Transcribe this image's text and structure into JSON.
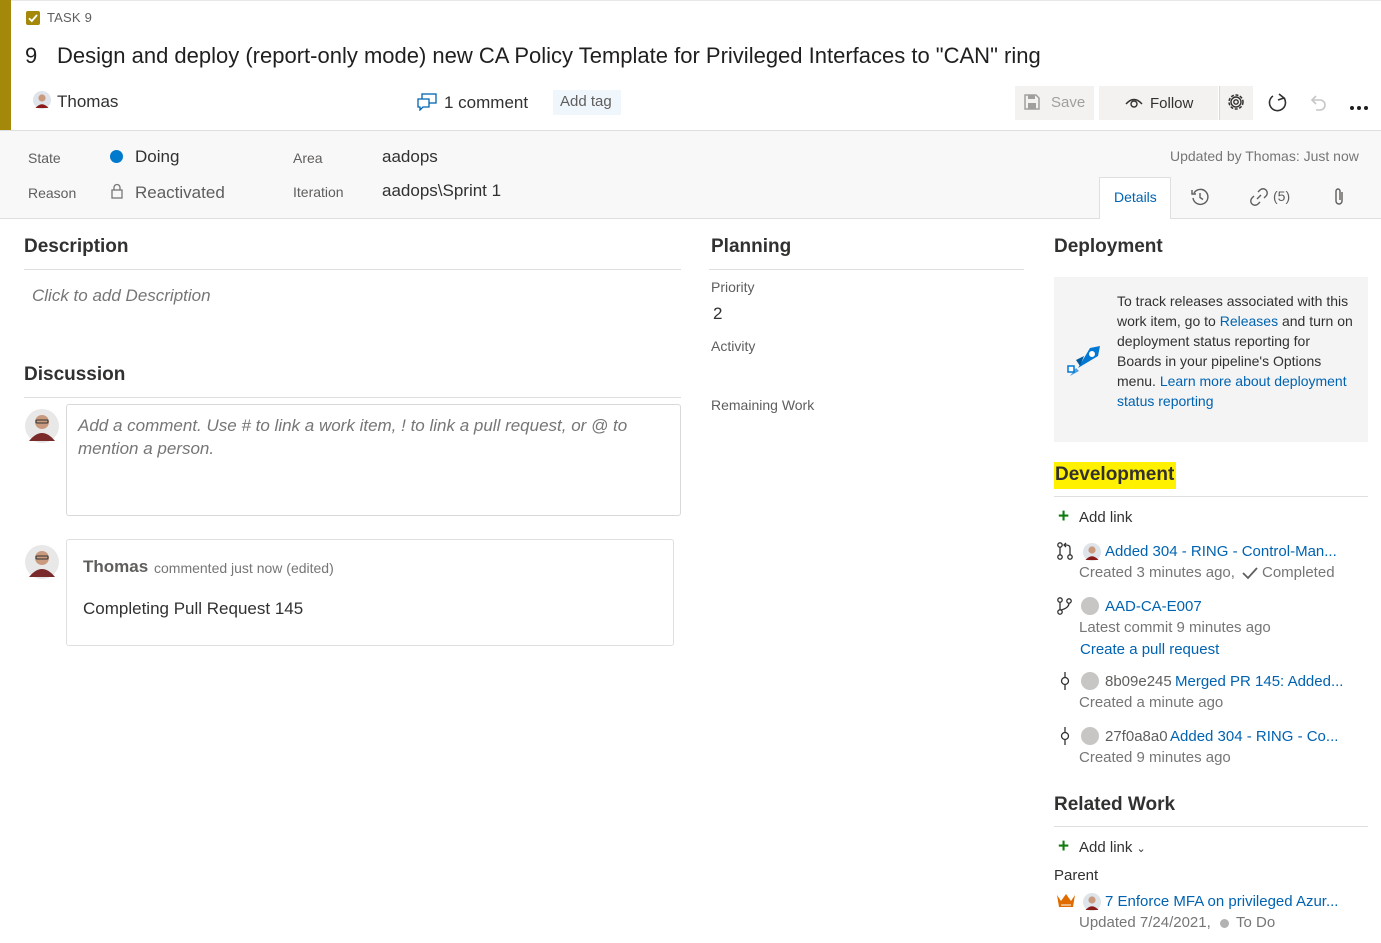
{
  "header": {
    "type_label": "TASK 9",
    "id": "9",
    "title": "Design and deploy (report-only mode) new CA Policy Template for Privileged Interfaces to \"CAN\" ring",
    "assignee": "Thomas",
    "comment_count": "1 comment",
    "add_tag": "Add tag",
    "accent_color": "#a4880a"
  },
  "toolbar": {
    "save_label": "Save",
    "follow_label": "Follow",
    "icons": [
      "save-icon",
      "eye-icon",
      "gear-icon",
      "refresh-icon",
      "undo-icon",
      "more-icon"
    ]
  },
  "fields": {
    "state_label": "State",
    "state_value": "Doing",
    "state_color": "#007acc",
    "reason_label": "Reason",
    "reason_value": "Reactivated",
    "area_label": "Area",
    "area_value": "aadops",
    "iteration_label": "Iteration",
    "iteration_value": "aadops\\Sprint 1",
    "updated_by": "Updated by Thomas: Just now"
  },
  "tabs": {
    "details": "Details",
    "links_count": "(5)"
  },
  "description": {
    "title": "Description",
    "placeholder": "Click to add Description"
  },
  "discussion": {
    "title": "Discussion",
    "input_placeholder": "Add a comment. Use # to link a work item, ! to link a pull request, or @ to mention a person.",
    "comment": {
      "author": "Thomas",
      "meta": "commented just now (edited)",
      "text": "Completing Pull Request 145"
    }
  },
  "planning": {
    "title": "Planning",
    "priority_label": "Priority",
    "priority_value": "2",
    "activity_label": "Activity",
    "remaining_label": "Remaining Work"
  },
  "deployment": {
    "title": "Deployment",
    "text_1": "To track releases associated with this work item, go to ",
    "releases_link": "Releases",
    "text_2": " and turn on deployment status reporting for Boards in your pipeline's Options menu. ",
    "learn_link": "Learn more about deployment status reporting"
  },
  "development": {
    "title": "Development",
    "add_link": "Add link",
    "items": [
      {
        "link": "Added 304 - RING - Control-Man...",
        "sub": "Created 3 minutes ago,",
        "status": "Completed"
      },
      {
        "link": "AAD-CA-E007",
        "sub": "Latest commit 9 minutes ago",
        "action": "Create a pull request"
      },
      {
        "hash": "8b09e245",
        "link": "Merged PR 145: Added...",
        "sub": "Created a minute ago"
      },
      {
        "hash": "27f0a8a0",
        "link": "Added 304 - RING - Co...",
        "sub": "Created 9 minutes ago"
      }
    ]
  },
  "related": {
    "title": "Related Work",
    "add_link": "Add link",
    "parent_label": "Parent",
    "parent_link": "7 Enforce MFA on privileged Azur...",
    "parent_updated": "Updated 7/24/2021,",
    "parent_state": "To Do"
  }
}
